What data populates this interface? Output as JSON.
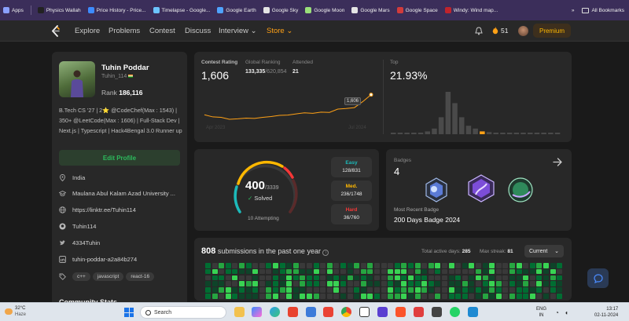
{
  "bookmarks": {
    "items": [
      {
        "label": "Apps",
        "color": "#8aa0ff"
      },
      {
        "label": "Physics Wallah",
        "color": "#222222"
      },
      {
        "label": "Price History - Price...",
        "color": "#3d8bff"
      },
      {
        "label": "Timelapse - Google...",
        "color": "#6cc4ff"
      },
      {
        "label": "Google Earth",
        "color": "#4fa3ff"
      },
      {
        "label": "Google Sky",
        "color": "#e4e4e4"
      },
      {
        "label": "Google Moon",
        "color": "#9adf7a"
      },
      {
        "label": "Google Mars",
        "color": "#e4e4e4"
      },
      {
        "label": "Google Space",
        "color": "#d23b3b"
      },
      {
        "label": "Windy: Wind map...",
        "color": "#c0242c"
      }
    ],
    "more": "»",
    "all_bookmarks": "All Bookmarks"
  },
  "nav": {
    "items": [
      "Explore",
      "Problems",
      "Contest",
      "Discuss",
      "Interview",
      "Store"
    ],
    "store_color": "#ffa116",
    "streak": "51",
    "premium": "Premium"
  },
  "profile": {
    "name": "Tuhin Poddar",
    "username": "Tuhin_114",
    "rank_label": "Rank",
    "rank_value": "186,116",
    "bio": "B.Tech CS '27 | 2⭐ @CodeChef(Max : 1543) | 350+ @LeetCode(Max : 1606) | Full-Stack Dev | Next.js | Typescript | Hack4Bengal 3.0 Runner up",
    "edit": "Edit Profile",
    "location": "India",
    "university": "Maulana Abul Kalam Azad University ...",
    "website": "https://linktr.ee/Tuhin114",
    "github": "Tuhin114",
    "twitter": "4334Tuhin",
    "linkedin": "tuhin-poddar-a2a84b274",
    "skills": [
      "c++",
      "javascript",
      "react-16"
    ],
    "community_stats": "Community Stats"
  },
  "contest": {
    "rating_label": "Contest Rating",
    "rating": "1,606",
    "global_label": "Global Ranking",
    "global_rank": "133,335",
    "global_total": "/620,854",
    "attended_label": "Attended",
    "attended": "21",
    "top_label": "Top",
    "top_value": "21.93%",
    "tooltip": "1,606",
    "x_start": "Apr 2023",
    "x_end": "Jul 2024",
    "accent": "#ffa116"
  },
  "chart_data": [
    {
      "type": "line",
      "title": "Contest Rating",
      "values": [
        1472,
        1458,
        1455,
        1442,
        1445,
        1450,
        1448,
        1455,
        1460,
        1468,
        1470,
        1478,
        1485,
        1482,
        1490,
        1488,
        1510,
        1514,
        1520,
        1560,
        1606
      ],
      "ylim": [
        1400,
        1620
      ]
    },
    {
      "type": "bar",
      "title": "Top",
      "values": [
        1,
        1,
        1,
        1,
        2,
        4,
        8,
        24,
        60,
        44,
        24,
        12,
        8,
        4,
        3,
        2,
        2,
        1,
        1,
        1,
        1,
        1,
        1,
        1,
        1
      ],
      "highlight_index": 13,
      "highlight_color": "#ffa116",
      "base_color": "#4a4a4a"
    }
  ],
  "solved": {
    "solved": "400",
    "total": "/3339",
    "solved_label": "Solved",
    "attempting": "10 Attempting",
    "easy_label": "Easy",
    "easy": "128/831",
    "easy_color": "#1cbaba",
    "medium_label": "Med.",
    "medium": "236/1748",
    "medium_color": "#ffb800",
    "hard_label": "Hard",
    "hard": "36/760",
    "hard_color": "#f63737"
  },
  "badges": {
    "label": "Badges",
    "count": "4",
    "recent_label": "Most Recent Badge",
    "recent": "200 Days Badge 2024"
  },
  "submissions": {
    "count": "808",
    "text": "submissions in the past one year",
    "active_label": "Total active days:",
    "active": "285",
    "streak_label": "Max streak:",
    "streak": "81",
    "period": "Current"
  },
  "taskbar": {
    "temp": "32°C",
    "weather": "Haze",
    "search": "Search",
    "lang1": "ENG",
    "lang2": "IN",
    "time": "13:17",
    "date": "02-11-2024"
  }
}
